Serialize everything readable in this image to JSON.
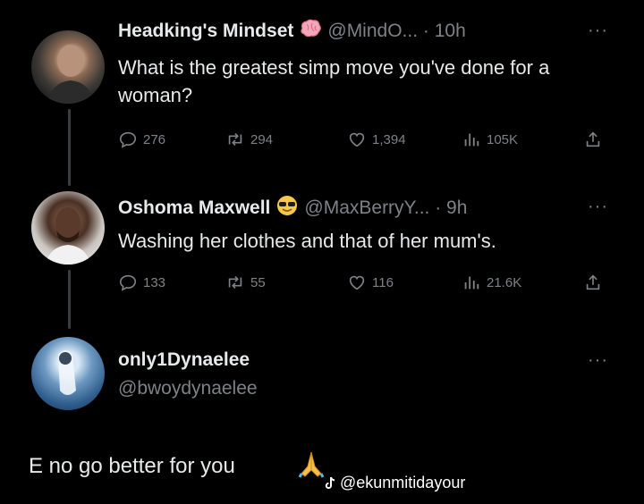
{
  "tweets": [
    {
      "name": "Headking's Mindset",
      "badge_icon": "brain-emoji",
      "handle": "@MindO... · 10h",
      "text": "What is the greatest simp move you've done for a woman?",
      "stats": {
        "replies": "276",
        "retweets": "294",
        "likes": "1,394",
        "views": "105K"
      }
    },
    {
      "name": "Oshoma Maxwell",
      "badge_icon": "sunglasses-emoji",
      "handle": "@MaxBerryY... · 9h",
      "text": "Washing her clothes and that of her mum's.",
      "stats": {
        "replies": "133",
        "retweets": "55",
        "likes": "116",
        "views": "21.6K"
      }
    }
  ],
  "composer": {
    "name": "only1Dynaelee",
    "handle": "@bwoydynaelee"
  },
  "more_glyph": "···",
  "reply_text": "E no go better for you",
  "reply_emoji": "folded-hands-emoji",
  "watermark": {
    "icon": "tiktok-icon",
    "text": "@ekunmitidayour"
  },
  "colors": {
    "background": "#000000",
    "text": "#e7e9ea",
    "muted": "#7d8287",
    "thread_line": "#3a3d41"
  }
}
